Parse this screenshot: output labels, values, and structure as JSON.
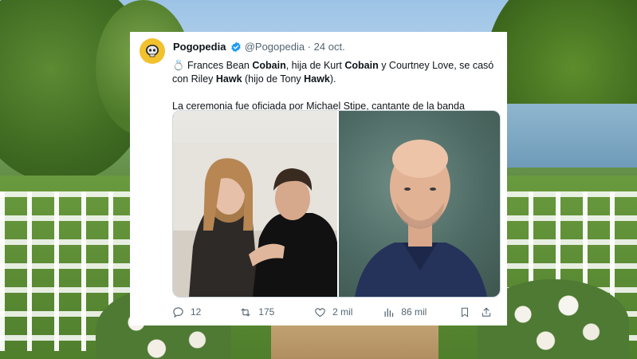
{
  "tweet": {
    "author_name": "Pogopedia",
    "author_handle": "@Pogopedia",
    "separator": "·",
    "date": "24 oct.",
    "line1": {
      "ring": "💍",
      "part1": " Frances Bean ",
      "bold1": "Cobain",
      "part2": ", hija de Kurt ",
      "bold2": "Cobain",
      "part3": " y Courtney Love, se casó"
    },
    "line2": {
      "part1": "con Riley ",
      "bold1": "Hawk",
      "part2": " (hijo de Tony ",
      "bold2": "Hawk",
      "part3": ")."
    },
    "paragraph2": "La ceremonia fue oficiada por Michael Stipe, cantante de la banda R.E.M.",
    "actions": {
      "replies": "12",
      "retweets": "175",
      "likes": "2 mil",
      "views": "86 mil"
    }
  },
  "colors": {
    "verified_blue": "#1d9bf0",
    "text_primary": "#0f1419",
    "text_secondary": "#536471",
    "avatar_bg": "#f2c12e"
  },
  "icons": [
    "verified-badge-icon",
    "reply-icon",
    "retweet-icon",
    "like-icon",
    "views-icon",
    "bookmark-icon",
    "share-icon"
  ]
}
